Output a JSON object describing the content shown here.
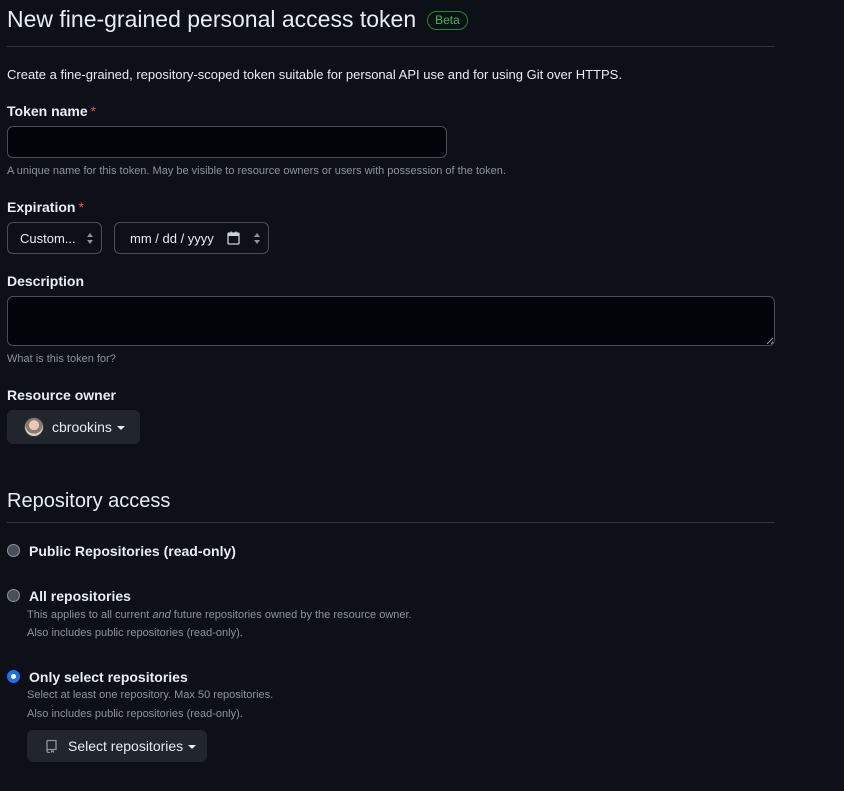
{
  "header": {
    "title": "New fine-grained personal access token",
    "badge": "Beta"
  },
  "intro": "Create a fine-grained, repository-scoped token suitable for personal API use and for using Git over HTTPS.",
  "token_name": {
    "label": "Token name",
    "required_mark": "*",
    "value": "",
    "placeholder": "",
    "hint": "A unique name for this token. May be visible to resource owners or users with possession of the token."
  },
  "expiration": {
    "label": "Expiration",
    "required_mark": "*",
    "select_value": "Custom...",
    "date_placeholder": "mm / dd / yyyy"
  },
  "description": {
    "label": "Description",
    "value": "",
    "hint": "What is this token for?"
  },
  "resource_owner": {
    "label": "Resource owner",
    "selected": "cbrookins"
  },
  "repository_access": {
    "title": "Repository access",
    "options": [
      {
        "label": "Public Repositories (read-only)",
        "selected": false
      },
      {
        "label": "All repositories",
        "selected": false,
        "note_pre": "This applies to all current ",
        "note_em": "and",
        "note_post": " future repositories owned by the resource owner.",
        "note2": "Also includes public repositories (read-only)."
      },
      {
        "label": "Only select repositories",
        "selected": true,
        "note1": "Select at least one repository. Max 50 repositories.",
        "note2": "Also includes public repositories (read-only)."
      }
    ],
    "select_button": "Select repositories"
  },
  "colors": {
    "accent": "#1f6feb",
    "success": "#3fb950",
    "danger": "#f85149",
    "background": "#0d1117"
  }
}
